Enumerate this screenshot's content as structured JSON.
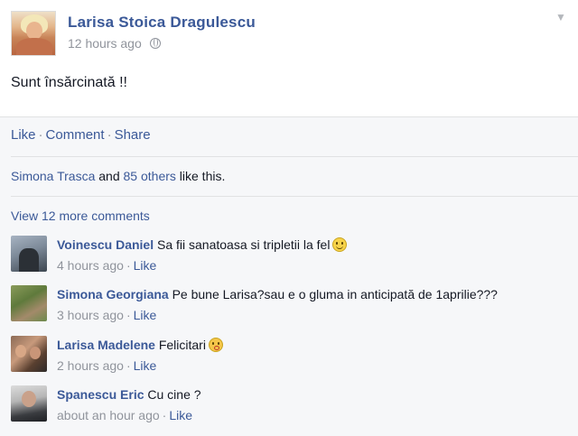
{
  "post": {
    "author": "Larisa Stoica Dragulescu",
    "timestamp": "12 hours ago",
    "privacy_icon": "globe-icon",
    "menu_icon": "chevron-down-icon",
    "status_text": "Sunt însărcinată !!"
  },
  "actions": {
    "like_label": "Like",
    "comment_label": "Comment",
    "share_label": "Share",
    "separator": "·"
  },
  "likes": {
    "name": "Simona Trasca",
    "connector": "and",
    "others": "85 others",
    "suffix": "like this."
  },
  "view_more_label": "View 12 more comments",
  "comments": [
    {
      "name": "Voinescu Daniel",
      "text": "Sa fii sanatoasa si tripletii la fel",
      "emoji": "smile",
      "time": "4 hours ago",
      "like_label": "Like"
    },
    {
      "name": "Simona Georgiana",
      "text": "Pe bune Larisa?sau e o gluma in anticipată de 1aprilie???",
      "emoji": "",
      "time": "3 hours ago",
      "like_label": "Like"
    },
    {
      "name": "Larisa Madelene",
      "text": "Felicitari",
      "emoji": "kiss",
      "time": "2 hours ago",
      "like_label": "Like"
    },
    {
      "name": "Spanescu Eric",
      "text": "Cu cine ?",
      "emoji": "",
      "time": "about an hour ago",
      "like_label": "Like"
    }
  ],
  "colors": {
    "link": "#3b5998",
    "meta": "#90949c",
    "feedback_bg": "#f6f7f9"
  }
}
